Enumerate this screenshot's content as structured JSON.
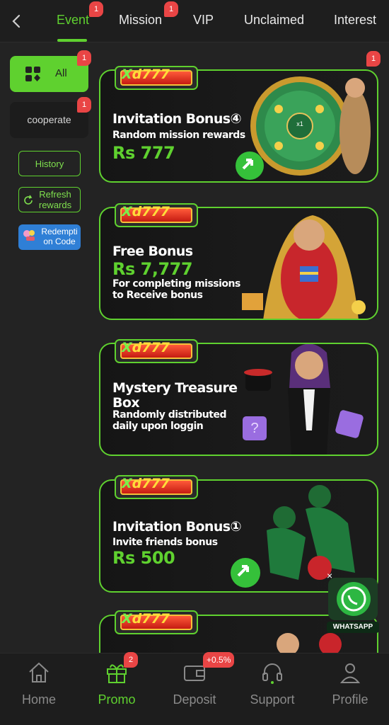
{
  "tabs": [
    {
      "label": "Event",
      "badge": "1",
      "active": true
    },
    {
      "label": "Mission",
      "badge": "1",
      "active": false
    },
    {
      "label": "VIP",
      "badge": "",
      "active": false
    },
    {
      "label": "Unclaimed",
      "badge": "",
      "active": false
    },
    {
      "label": "Interest",
      "badge": "",
      "active": false
    }
  ],
  "sidebar": {
    "all_label": "All",
    "all_badge": "1",
    "cooperate_label": "cooperate",
    "cooperate_badge": "1",
    "history_label": "History",
    "refresh_label": "Refresh rewards",
    "redeem_label": "Redempti on Code"
  },
  "cards": [
    {
      "title": "Invitation Bonus④",
      "subtitle": "Random mission rewards",
      "amount": "Rs 777",
      "badge": "1",
      "logo": "Xd777"
    },
    {
      "title": "Free Bonus",
      "amount": "Rs 7,777",
      "subtitle": "For completing missions to Receive bonus",
      "logo": "Xd777"
    },
    {
      "title": "Mystery Treasure Box",
      "subtitle": "Randomly distributed daily upon loggin",
      "logo": "Xd777"
    },
    {
      "title": "Invitation Bonus①",
      "subtitle": "Invite friends bonus",
      "amount": "Rs 500",
      "logo": "Xd777"
    },
    {
      "logo": "Xd777"
    }
  ],
  "whatsapp": {
    "label": "WHATSAPP",
    "close": "×"
  },
  "bottom_nav": [
    {
      "label": "Home",
      "icon": "home-icon",
      "badge": ""
    },
    {
      "label": "Promo",
      "icon": "gift-icon",
      "badge": "2",
      "active": true
    },
    {
      "label": "Deposit",
      "icon": "wallet-icon",
      "badge": "+0.5%"
    },
    {
      "label": "Support",
      "icon": "headset-icon",
      "badge": ""
    },
    {
      "label": "Profile",
      "icon": "person-icon",
      "badge": ""
    }
  ],
  "colors": {
    "accent": "#5fd12f",
    "badge": "#e94545",
    "background": "#232323"
  }
}
